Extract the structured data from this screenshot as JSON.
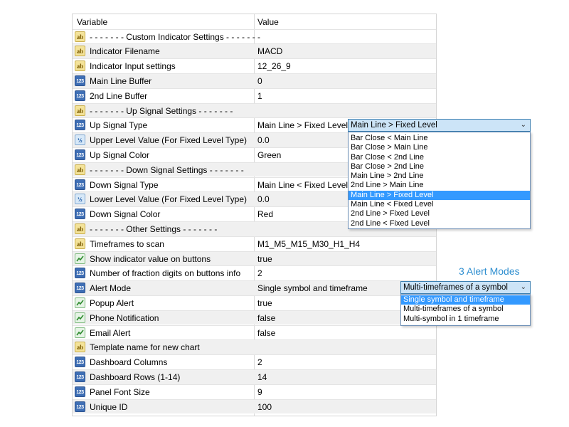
{
  "header": {
    "col_variable": "Variable",
    "col_value": "Value"
  },
  "rows": [
    {
      "type": "ab",
      "label": "- - - - - - - Custom Indicator Settings - - - - - - -",
      "value": ""
    },
    {
      "type": "ab",
      "label": "Indicator Filename",
      "value": "MACD"
    },
    {
      "type": "ab",
      "label": "Indicator Input settings",
      "value": "12_26_9"
    },
    {
      "type": "num",
      "label": "Main Line Buffer",
      "value": "0"
    },
    {
      "type": "num",
      "label": "2nd Line Buffer",
      "value": "1"
    },
    {
      "type": "ab",
      "label": "- - - - - - - Up Signal Settings - - - - - - -",
      "value": ""
    },
    {
      "type": "num",
      "label": "Up Signal Type",
      "value": "Main Line > Fixed Level"
    },
    {
      "type": "frac",
      "label": "Upper Level Value (For Fixed Level Type)",
      "value": "0.0"
    },
    {
      "type": "num",
      "label": "Up Signal Color",
      "value": "Green"
    },
    {
      "type": "ab",
      "label": "- - - - - - - Down Signal Settings - - - - - - -",
      "value": ""
    },
    {
      "type": "num",
      "label": "Down Signal Type",
      "value": "Main Line < Fixed Level"
    },
    {
      "type": "frac",
      "label": "Lower Level Value (For Fixed Level Type)",
      "value": "0.0"
    },
    {
      "type": "num",
      "label": "Down Signal Color",
      "value": "Red"
    },
    {
      "type": "ab",
      "label": "- - - - - - - Other Settings - - - - - - -",
      "value": ""
    },
    {
      "type": "ab",
      "label": "Timeframes to scan",
      "value": "M1_M5_M15_M30_H1_H4"
    },
    {
      "type": "bool",
      "label": "Show indicator value on buttons",
      "value": "true"
    },
    {
      "type": "num",
      "label": "Number of fraction digits on buttons info",
      "value": "2"
    },
    {
      "type": "num",
      "label": "Alert Mode",
      "value": "Single symbol and timeframe"
    },
    {
      "type": "bool",
      "label": "Popup Alert",
      "value": "true"
    },
    {
      "type": "bool",
      "label": "Phone Notification",
      "value": "false"
    },
    {
      "type": "bool",
      "label": "Email Alert",
      "value": "false"
    },
    {
      "type": "ab",
      "label": "Template name for new chart",
      "value": ""
    },
    {
      "type": "num",
      "label": "Dashboard Columns",
      "value": "2"
    },
    {
      "type": "num",
      "label": "Dashboard Rows (1-14)",
      "value": "14"
    },
    {
      "type": "num",
      "label": "Panel Font Size",
      "value": "9"
    },
    {
      "type": "num",
      "label": "Unique ID",
      "value": "100"
    }
  ],
  "icon_text": {
    "ab": "ab",
    "num": "123",
    "frac": "½"
  },
  "signal_dropdown": {
    "selected": "Main Line > Fixed Level",
    "options": [
      "Bar Close < Main Line",
      "Bar Close > Main Line",
      "Bar Close < 2nd Line",
      "Bar Close > 2nd Line",
      "Main Line > 2nd Line",
      "2nd Line > Main Line",
      "Main Line > Fixed Level",
      "Main Line < Fixed Level",
      "2nd Line > Fixed Level",
      "2nd Line < Fixed Level"
    ],
    "highlighted_index": 6
  },
  "alert_dropdown": {
    "selected": "Multi-timeframes of a symbol",
    "options": [
      "Single symbol and timeframe",
      "Multi-timeframes of a symbol",
      "Multi-symbol in 1 timeframe"
    ],
    "highlighted_index": 0
  },
  "caption": "3 Alert Modes",
  "colors": {
    "accent": "#3399ff",
    "caption": "#2f8fd0",
    "dropdown_head": "#cce4f7"
  }
}
